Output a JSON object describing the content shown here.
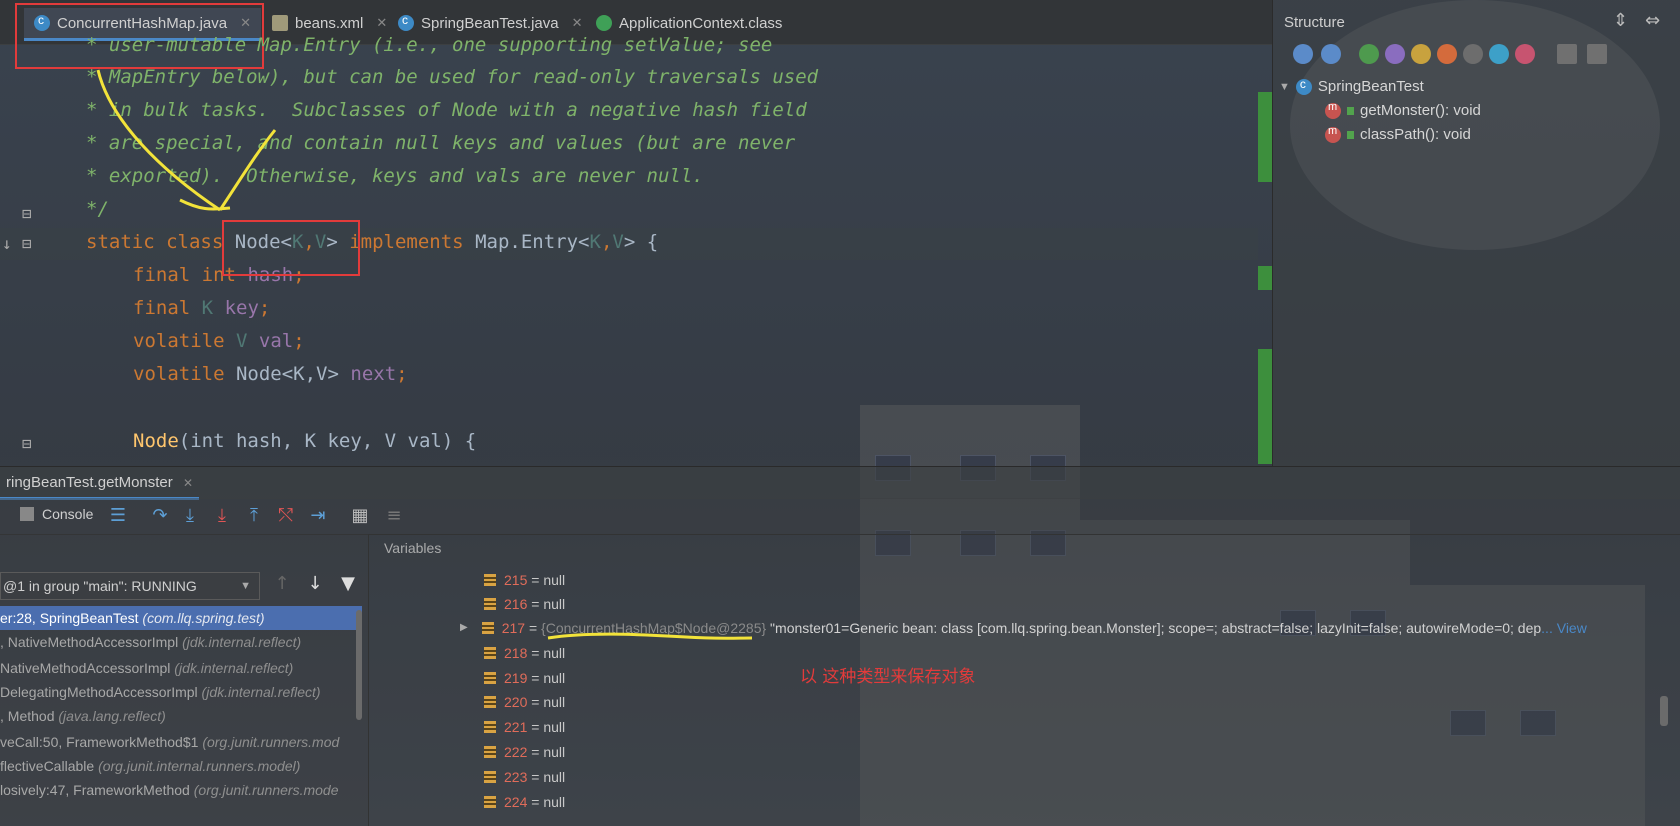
{
  "tabs": [
    {
      "label": "ConcurrentHashMap.java",
      "icon": "java-class-icon",
      "active": true
    },
    {
      "label": "beans.xml",
      "icon": "xml-file-icon"
    },
    {
      "label": "SpringBeanTest.java",
      "icon": "java-class-icon"
    },
    {
      "label": "ApplicationContext.class",
      "icon": "interface-icon"
    }
  ],
  "editor": {
    "comment_lines": [
      "* user-mutable Map.Entry (i.e., one supporting setValue; see",
      "* MapEntry below), but can be used for read-only traversals used",
      "* in bulk tasks.  Subclasses of Node with a negative hash field",
      "* are special, and contain null keys and values (but are never",
      "* exported).  Otherwise, keys and vals are never null.",
      "*/"
    ],
    "class_decl": {
      "kw1": "static",
      "kw2": "class",
      "name": "Node",
      "tp_open": "<",
      "k": "K",
      "comma": ",",
      "v": "V",
      "tp_close": ">",
      "impl": "implements",
      "iface": "Map.Entry",
      "brace": "{"
    },
    "fields": [
      {
        "mods": "final",
        "type": "int",
        "name": "hash",
        "end": ";"
      },
      {
        "mods": "final",
        "type": "K",
        "name": "key",
        "end": ";"
      },
      {
        "mods": "volatile",
        "type": "V",
        "name": "val",
        "end": ";"
      },
      {
        "mods": "volatile",
        "type": "Node<K,V>",
        "name": "next",
        "end": ";"
      }
    ],
    "ctor": {
      "name": "Node",
      "params": "(int hash, K key, V val) {"
    }
  },
  "structure": {
    "title": "Structure",
    "root": "SpringBeanTest",
    "members": [
      "getMonster(): void",
      "classPath(): void"
    ]
  },
  "debug": {
    "session_tab": "ringBeanTest.getMonster",
    "console_label": "Console",
    "thread_selector": "@1 in group \"main\": RUNNING",
    "frames": [
      {
        "method": "er:28, SpringBeanTest",
        "pkg": "(com.llq.spring.test)"
      },
      {
        "method": ", NativeMethodAccessorImpl",
        "pkg": "(jdk.internal.reflect)"
      },
      {
        "method": " NativeMethodAccessorImpl",
        "pkg": "(jdk.internal.reflect)"
      },
      {
        "method": " DelegatingMethodAccessorImpl",
        "pkg": "(jdk.internal.reflect)"
      },
      {
        "method": ", Method",
        "pkg": "(java.lang.reflect)"
      },
      {
        "method": "veCall:50, FrameworkMethod$1",
        "pkg": "(org.junit.runners.mod"
      },
      {
        "method": "flectiveCallable",
        "pkg": "(org.junit.internal.runners.model)"
      },
      {
        "method": "losively:47, FrameworkMethod",
        "pkg": "(org.junit.runners.mode"
      }
    ],
    "variables_title": "Variables",
    "variables": [
      {
        "idx": "215",
        "val": " = null"
      },
      {
        "idx": "216",
        "val": " = null"
      },
      {
        "idx": "217",
        "val": " = ",
        "obj": "{ConcurrentHashMap$Node@2285}",
        "str": " \"monster01=Generic bean: class [com.llq.spring.bean.Monster]; scope=; abstract=false; lazyInit=false; autowireMode=0; dep",
        "more": "... View"
      },
      {
        "idx": "218",
        "val": " = null"
      },
      {
        "idx": "219",
        "val": " = null"
      },
      {
        "idx": "220",
        "val": " = null"
      },
      {
        "idx": "221",
        "val": " = null"
      },
      {
        "idx": "222",
        "val": " = null"
      },
      {
        "idx": "223",
        "val": " = null"
      },
      {
        "idx": "224",
        "val": " = null"
      }
    ],
    "annotation": "以 这种类型来保存对象"
  }
}
